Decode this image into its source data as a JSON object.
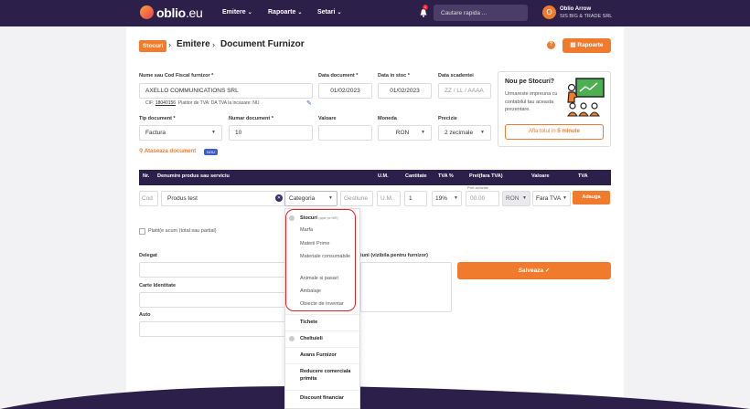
{
  "app": {
    "logo_brand": "oblio",
    "logo_suffix": ".eu"
  },
  "nav": {
    "items": [
      {
        "label": "Emitere",
        "caret": "⌄"
      },
      {
        "label": "Rapoarte",
        "caret": "⌄"
      },
      {
        "label": "Setari",
        "caret": "⌄"
      }
    ],
    "notifications_count": "1",
    "search_placeholder": "Cautare rapida ...",
    "user_initial": "O",
    "user_name": "Oblio Arrow",
    "user_company": "SIS BIG & TRADE SRL"
  },
  "breadcrumb": {
    "root": "Stocuri",
    "sep": "›",
    "level1": "Emitere",
    "level2": "Document Furnizor"
  },
  "header": {
    "help": "?",
    "rapoarte_label": "Rapoarte"
  },
  "form": {
    "furnizor_label": "Nume sau Cod Fiscal furnizor *",
    "furnizor_value": "AXELLO COMMUNICATIONS SRL",
    "cif_label": "CIF:",
    "cif_value": "18040156",
    "cif_extra": "Platitor de TVA: DA   TVA la incasare: NU",
    "data_document_label": "Data document *",
    "data_document_value": "01/02/2023",
    "data_stoc_label": "Data in stoc *",
    "data_stoc_value": "01/02/2023",
    "data_scadenta_label": "Data scadentei",
    "data_scadenta_placeholder": "ZZ / LL / AAAA",
    "tip_document_label": "Tip document *",
    "tip_document_value": "Factura",
    "numar_document_label": "Numar document *",
    "numar_document_value": "10",
    "valoare_label": "Valoare",
    "moneda_label": "Moneda",
    "moneda_value": "RON",
    "precizie_label": "Precizie",
    "precizie_value": "2 zecimale",
    "ataseaza_label": "Ataseaza document",
    "nou_badge": "NOU"
  },
  "promo": {
    "title": "Nou pe Stocuri?",
    "text": "Urmareste impreuna cu contabilul tau aceasta prezentare.",
    "button_prefix": "Afla totul in ",
    "button_strong": "5 minute"
  },
  "table": {
    "headers": [
      "Nr.",
      "Denumire produs sau serviciu",
      "U.M.",
      "Cantitate",
      "TVA %",
      "Pret(fara TVA)",
      "Valoare",
      "TVA"
    ],
    "pret_achizitie_hint": "Pret achizitie",
    "row": {
      "cod_placeholder": "Cod",
      "produs_value": "Produs test",
      "categoria_value": "Categoria",
      "gestiune_placeholder": "Gestiune",
      "um_placeholder": "U.M.",
      "cantitate_value": "1",
      "tva_value": "19%",
      "pret_placeholder": "00.00",
      "moneda_value": "RON",
      "fara_tva_value": "Fara TVA",
      "adauga_label": "Adauga"
    }
  },
  "dropdown": {
    "stocuri_group": "Stocuri",
    "stocuri_sub": "(apar pe NIR)",
    "stocuri_items": [
      "Marfa",
      "Materii Prime",
      "Materiale consumabile",
      "Animale si pasari",
      "Ambalaje",
      "Obiecte de inventar"
    ],
    "tichete": "Tichete",
    "cheltuieli": "Cheltuieli",
    "avans": "Avans Furnizor",
    "reducere": "Reducere comerciala primita",
    "discount": "Discount financiar"
  },
  "lower": {
    "platit_label": "Platit(e acum (total sau partial)",
    "delegat_label": "Delegat",
    "mentiuni_label": "Mentiuni (vizibila pentru furnizor)",
    "carte_label": "Carte Identitate",
    "auto_label": "Auto",
    "salveaza_label": "Salveaza ✓"
  },
  "colors": {
    "brand_dark": "#2c1f4a",
    "accent": "#f07b2d",
    "highlight": "#d9262c"
  }
}
